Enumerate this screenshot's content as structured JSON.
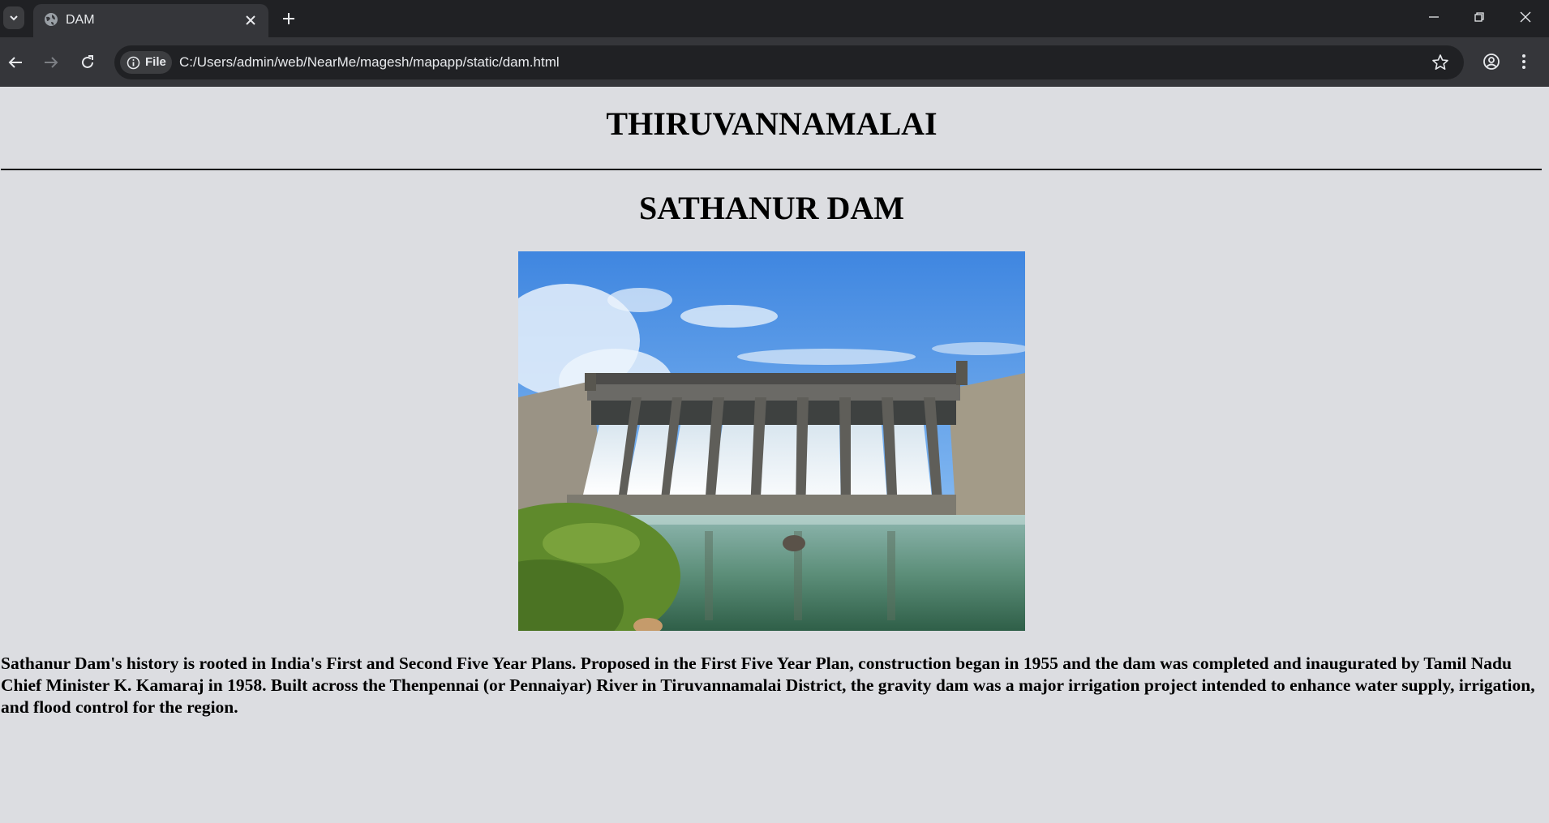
{
  "browser": {
    "tab_title": "DAM",
    "address_chip": "File",
    "url": "C:/Users/admin/web/NearMe/magesh/mapapp/static/dam.html"
  },
  "page": {
    "heading": "THIRUVANNAMALAI",
    "subheading": "SATHANUR DAM",
    "description": "Sathanur Dam's history is rooted in India's First and Second Five Year Plans. Proposed in the First Five Year Plan, construction began in 1955 and the dam was completed and inaugurated by Tamil Nadu Chief Minister K. Kamaraj in 1958. Built across the Thenpennai (or Pennaiyar) River in Tiruvannamalai District, the gravity dam was a major irrigation project intended to enhance water supply, irrigation, and flood control for the region."
  },
  "icons": [
    "tab-search-icon",
    "globe-icon",
    "close-icon",
    "plus-icon",
    "minimize-icon",
    "restore-icon",
    "window-close-icon",
    "back-icon",
    "forward-icon",
    "reload-icon",
    "info-icon",
    "star-icon",
    "profile-icon",
    "menu-icon"
  ],
  "colors": {
    "page_background": "#dcdde1",
    "chrome_dark": "#202124",
    "chrome_toolbar": "#35363a"
  }
}
